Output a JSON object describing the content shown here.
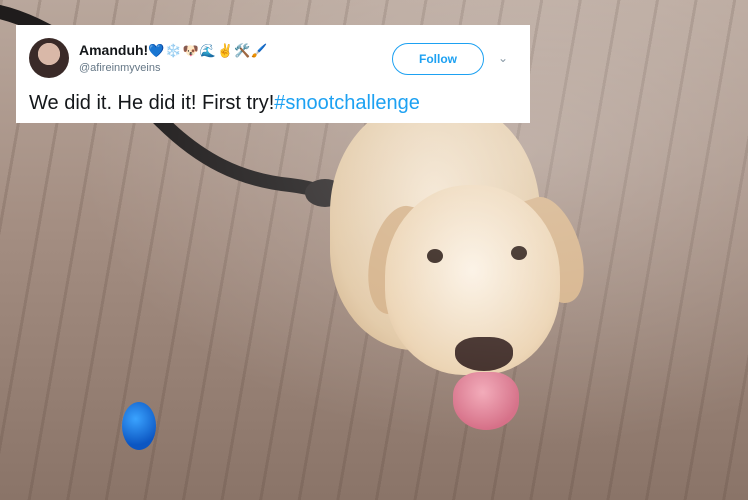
{
  "tweet": {
    "display_name": "Amanduh!",
    "name_emojis": "💙❄️🐶🌊✌️🛠️🖌️",
    "handle": "@afireinmyveins",
    "follow_label": "Follow",
    "chevron_icon": "chevron-down-icon",
    "text_main": "We did it. He did it! First try!",
    "hashtag": "#snootchallenge"
  },
  "colors": {
    "twitter_blue": "#1da1f2",
    "text_dark": "#14171a",
    "text_muted": "#657786"
  }
}
